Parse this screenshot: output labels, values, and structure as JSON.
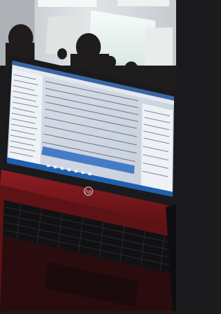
{
  "photo": {
    "colors": {
      "wall": "#d9dcdf",
      "projector_screen": "#e9f3ef",
      "laptop_red": "#8d1c20",
      "keyboard": "#151518",
      "screen_bg": "#cdd6e2",
      "taskbar": "#1d5fb0"
    },
    "icons": [
      "hp-logo-icon"
    ]
  }
}
